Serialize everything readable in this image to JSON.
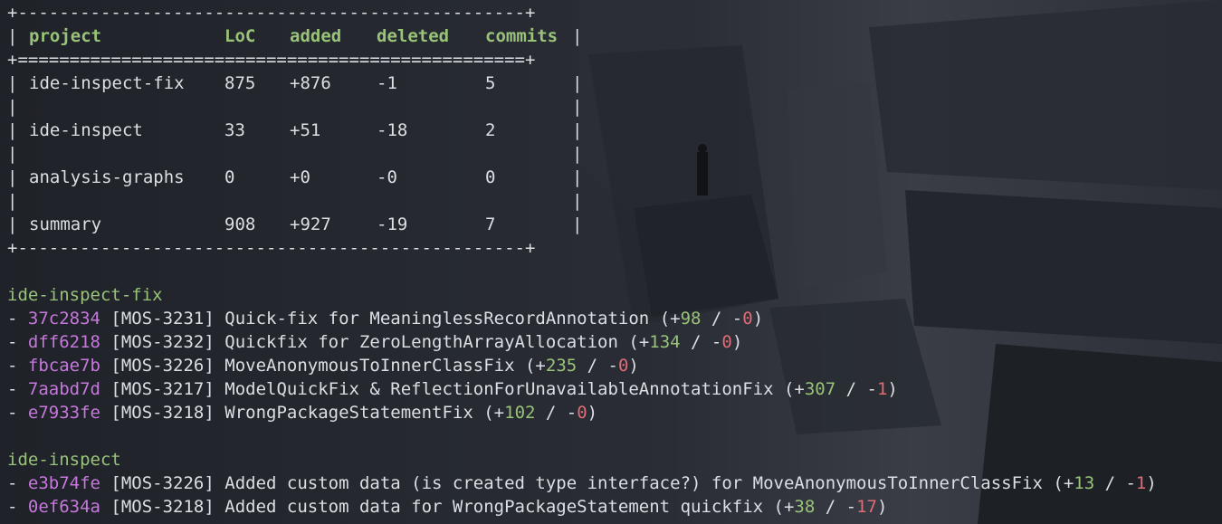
{
  "table": {
    "border_top": "+-------------------------------------------------+",
    "border_mid": "+=================================================+",
    "border_bottom": "+-------------------------------------------------+",
    "headers": [
      "project",
      "LoC",
      "added",
      "deleted",
      "commits"
    ],
    "rows": [
      [
        "ide-inspect-fix",
        "875",
        "+876",
        "-1",
        "5"
      ],
      [
        "ide-inspect",
        "33",
        "+51",
        "-18",
        "2"
      ],
      [
        "analysis-graphs",
        "0",
        "+0",
        "-0",
        "0"
      ],
      [
        "summary",
        "908",
        "+927",
        "-19",
        "7"
      ]
    ]
  },
  "sections": [
    {
      "name": "ide-inspect-fix",
      "commits": [
        {
          "hash": "37c2834",
          "message": "[MOS-3231] Quick-fix for MeaninglessRecordAnnotation",
          "added": "98",
          "deleted": "0"
        },
        {
          "hash": "dff6218",
          "message": "[MOS-3232] Quickfix for ZeroLengthArrayAllocation",
          "added": "134",
          "deleted": "0"
        },
        {
          "hash": "fbcae7b",
          "message": "[MOS-3226] MoveAnonymousToInnerClassFix",
          "added": "235",
          "deleted": "0"
        },
        {
          "hash": "7aabd7d",
          "message": "[MOS-3217] ModelQuickFix & ReflectionForUnavailableAnnotationFix",
          "added": "307",
          "deleted": "1"
        },
        {
          "hash": "e7933fe",
          "message": "[MOS-3218] WrongPackageStatementFix",
          "added": "102",
          "deleted": "0"
        }
      ]
    },
    {
      "name": "ide-inspect",
      "commits": [
        {
          "hash": "e3b74fe",
          "message": "[MOS-3226] Added custom data (is created type interface?) for MoveAnonymousToInnerClassFix",
          "added": "13",
          "deleted": "1"
        },
        {
          "hash": "0ef634a",
          "message": "[MOS-3218] Added custom data for WrongPackageStatement quickfix",
          "added": "38",
          "deleted": "17"
        }
      ]
    }
  ],
  "colors": {
    "background": "#1e2127",
    "header": "#98c379",
    "added": "#98c379",
    "deleted": "#e06c75",
    "hash": "#c678dd",
    "text": "#dcdfe4"
  }
}
